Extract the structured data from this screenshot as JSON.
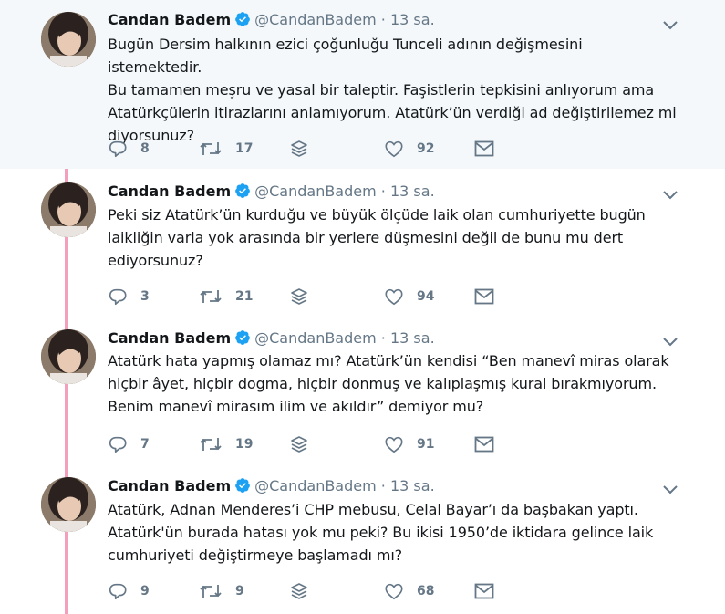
{
  "author": {
    "name": "Candan Badem",
    "handle": "@CandanBadem",
    "separator": "·"
  },
  "colors": {
    "thread_line": "#f4a0bd",
    "verified": "#1da1f2",
    "muted": "#657786",
    "highlight_bg": "#f5f8fa"
  },
  "icons": [
    "verified-badge-icon",
    "chevron-down-icon",
    "reply-icon",
    "retweet-icon",
    "stack-icon",
    "heart-icon",
    "envelope-icon"
  ],
  "tweets": [
    {
      "time": "13 sa.",
      "text": [
        "Bugün Dersim halkının ezici çoğunluğu Tunceli adının değişmesini istemektedir.",
        "Bu tamamen meşru ve yasal bir taleptir. Faşistlerin tepkisini anlıyorum ama",
        "Atatürkçülerin itirazlarını anlamıyorum. Atatürk’ün verdiği ad değiştirilemez mi",
        "diyorsunuz?"
      ],
      "replies": "8",
      "retweets": "17",
      "likes": "92"
    },
    {
      "time": "13 sa.",
      "text": [
        "Peki siz Atatürk’ün kurduğu ve büyük ölçüde laik olan cumhuriyette bugün",
        "laikliğin varla yok arasında bir yerlere düşmesini değil de bunu mu dert",
        "ediyorsunuz?"
      ],
      "replies": "3",
      "retweets": "21",
      "likes": "94"
    },
    {
      "time": "13 sa.",
      "text": [
        "Atatürk hata yapmış olamaz mı? Atatürk’ün kendisi “Ben manevî miras olarak",
        "hiçbir âyet, hiçbir dogma, hiçbir donmuş ve kalıplaşmış kural bırakmıyorum.",
        "Benim manevî mirasım ilim ve akıldır” demiyor mu?"
      ],
      "replies": "7",
      "retweets": "19",
      "likes": "91"
    },
    {
      "time": "13 sa.",
      "text": [
        "Atatürk, Adnan Menderes’i CHP mebusu, Celal Bayar’ı da başbakan yaptı.",
        "Atatürk'ün burada hatası yok mu peki? Bu ikisi 1950’de iktidara gelince laik",
        "cumhuriyeti değiştirmeye başlamadı mı?"
      ],
      "replies": "9",
      "retweets": "9",
      "likes": "68"
    }
  ]
}
